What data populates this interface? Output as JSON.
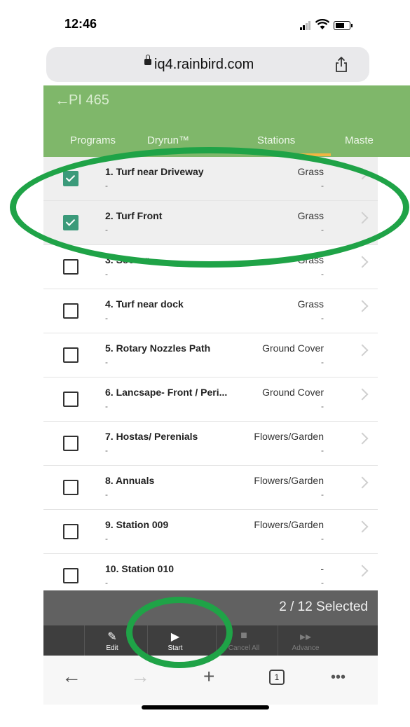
{
  "status_bar": {
    "time": "12:46"
  },
  "browser": {
    "url": "iq4.rainbird.com",
    "tab_count": "1"
  },
  "header": {
    "back_icon": "arrow-left-icon",
    "title": "PI 465"
  },
  "tabs": [
    {
      "label": "Programs"
    },
    {
      "label": "Dryrun™"
    },
    {
      "label": "Stations",
      "active": true
    },
    {
      "label": "Maste"
    }
  ],
  "stations": [
    {
      "name": "1. Turf near Driveway",
      "type": "Grass",
      "sub1": "-",
      "sub2": "-",
      "checked": true
    },
    {
      "name": "2. Turf Front",
      "type": "Grass",
      "sub1": "-",
      "sub2": "-",
      "checked": true
    },
    {
      "name": "3. Soccer",
      "type": "Grass",
      "sub1": "-",
      "sub2": "-",
      "checked": false
    },
    {
      "name": "4. Turf near dock",
      "type": "Grass",
      "sub1": "-",
      "sub2": "-",
      "checked": false
    },
    {
      "name": "5. Rotary Nozzles Path",
      "type": "Ground Cover",
      "sub1": "-",
      "sub2": "-",
      "checked": false
    },
    {
      "name": "6. Lancsape- Front / Peri...",
      "type": "Ground Cover",
      "sub1": "-",
      "sub2": "-",
      "checked": false
    },
    {
      "name": "7. Hostas/ Perenials",
      "type": "Flowers/Garden",
      "sub1": "-",
      "sub2": "-",
      "checked": false
    },
    {
      "name": "8. Annuals",
      "type": "Flowers/Garden",
      "sub1": "-",
      "sub2": "-",
      "checked": false
    },
    {
      "name": "9. Station 009",
      "type": "Flowers/Garden",
      "sub1": "-",
      "sub2": "-",
      "checked": false
    },
    {
      "name": "10. Station 010",
      "type": "-",
      "sub1": "-",
      "sub2": "-",
      "checked": false
    }
  ],
  "selection": {
    "text": "2 / 12 Selected"
  },
  "actions": [
    {
      "label": "Edit",
      "icon": "pencil-icon",
      "enabled": true
    },
    {
      "label": "Start",
      "icon": "play-icon",
      "enabled": true
    },
    {
      "label": "Cancel All",
      "icon": "stop-icon",
      "enabled": false
    },
    {
      "label": "Advance",
      "icon": "fast-forward-icon",
      "enabled": false
    }
  ],
  "colors": {
    "header_green": "#7fb76a",
    "tab_indicator": "#f2b542",
    "checkbox_checked": "#3b9a7a",
    "annotation_ring": "#1fa347"
  }
}
